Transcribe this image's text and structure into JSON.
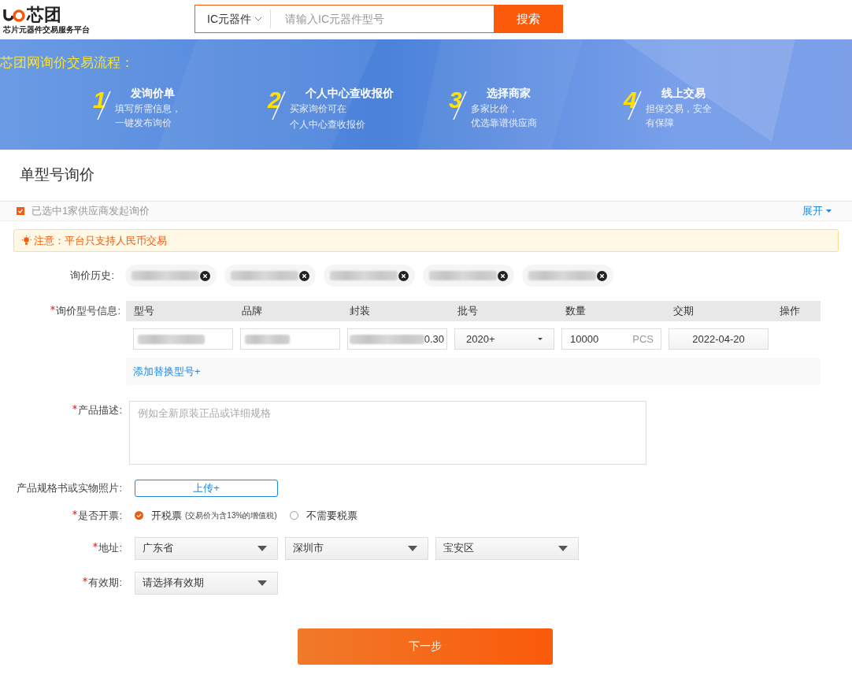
{
  "header": {
    "logo_mark": "芯团",
    "logo_tagline": "芯片元器件交易服务平台",
    "search": {
      "category": "IC元器件",
      "placeholder": "请输入IC元器件型号",
      "button": "搜索"
    }
  },
  "banner": {
    "title": "芯团网询价交易流程：",
    "steps": [
      {
        "number": "1",
        "title": "发询价单",
        "lines": [
          "填写所需信息，",
          "一键发布询价"
        ]
      },
      {
        "number": "2",
        "title": "个人中心查收报价",
        "lines": [
          "买家询价可在",
          "个人中心查收报价"
        ]
      },
      {
        "number": "3",
        "title": "选择商家",
        "lines": [
          "多家比价，",
          "优选靠谱供应商"
        ]
      },
      {
        "number": "4",
        "title": "线上交易",
        "lines": [
          "担保交易，安全",
          "有保障"
        ]
      }
    ]
  },
  "section_title": "单型号询价",
  "supplier_bar": {
    "text": "已选中1家供应商发起询价",
    "checked": true,
    "expand": "展开"
  },
  "notice": "注意：平台只支持人民币交易",
  "history": {
    "label": "询价历史:",
    "chips": [
      {
        "kind": "blurred"
      },
      {
        "kind": "blurred"
      },
      {
        "kind": "blurred"
      },
      {
        "kind": "blurred"
      },
      {
        "kind": "blurred"
      }
    ]
  },
  "model_table": {
    "label": "询价型号信息:",
    "required": true,
    "columns": [
      "型号",
      "品牌",
      "封装",
      "批号",
      "数量",
      "交期",
      "操作"
    ],
    "row": {
      "model": {
        "kind": "blurred"
      },
      "brand": {
        "kind": "blurred"
      },
      "package": {
        "kind": "blurred",
        "tail": "0.30"
      },
      "batch": "2020+",
      "quantity": "10000",
      "unit": "PCS",
      "delivery": "2022-04-20"
    },
    "add_link": "添加替换型号+"
  },
  "description": {
    "label": "产品描述:",
    "required": true,
    "placeholder": "例如全新原装正品或详细规格"
  },
  "upload": {
    "label": "产品规格书或实物照片:",
    "required": false,
    "button": "上传+"
  },
  "invoice": {
    "label": "是否开票:",
    "required": true,
    "options": [
      {
        "label": "开税票",
        "note": "(交易价为含13%的增值税)",
        "selected": true
      },
      {
        "label": "不需要税票",
        "selected": false
      }
    ]
  },
  "address": {
    "label": "地址:",
    "required": true,
    "selects": [
      "广东省",
      "深圳市",
      "宝安区"
    ]
  },
  "validity": {
    "label": "有效期:",
    "required": true,
    "select": "请选择有效期"
  },
  "next_button": "下一步"
}
